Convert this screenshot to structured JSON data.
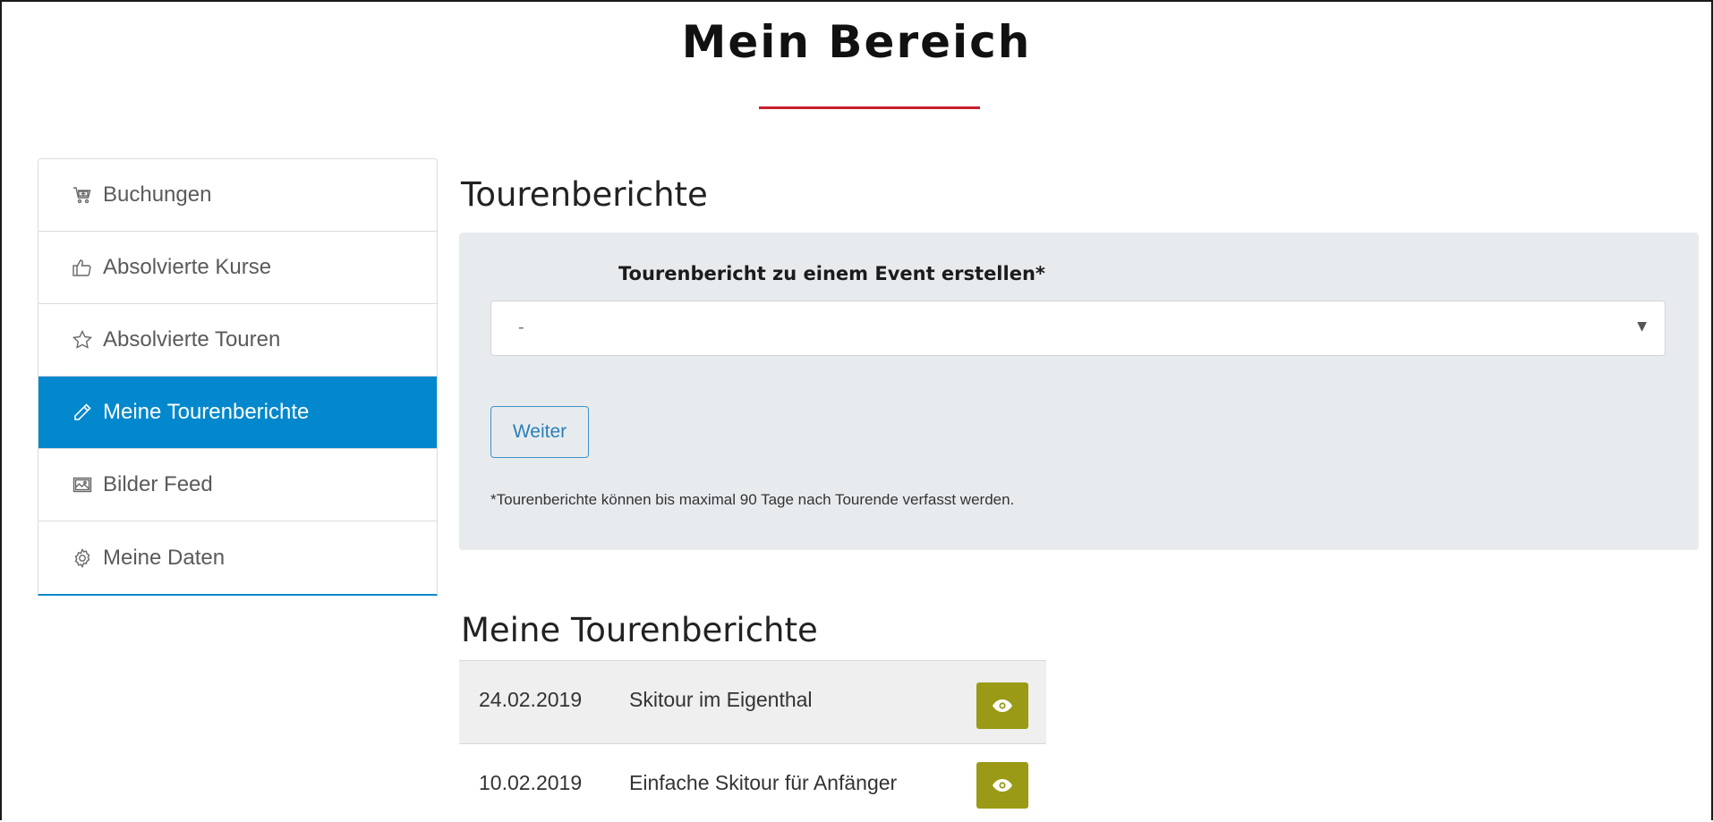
{
  "page": {
    "title": "Mein Bereich"
  },
  "sidebar": {
    "items": [
      {
        "label": "Buchungen",
        "icon": "cart-icon",
        "active": false
      },
      {
        "label": "Absolvierte Kurse",
        "icon": "thumbs-up-icon",
        "active": false
      },
      {
        "label": "Absolvierte Touren",
        "icon": "star-icon",
        "active": false
      },
      {
        "label": "Meine Tourenberichte",
        "icon": "pencil-icon",
        "active": true
      },
      {
        "label": "Bilder Feed",
        "icon": "image-icon",
        "active": false
      },
      {
        "label": "Meine Daten",
        "icon": "gear-icon",
        "active": false
      }
    ],
    "accent_color": "#0488cd"
  },
  "main": {
    "heading": "Tourenberichte",
    "form": {
      "label": "Tourenbericht zu einem Event erstellen*",
      "select_value": "-",
      "select_arrow": "▼",
      "button_label": "Weiter",
      "note": "*Tourenberichte können bis maximal 90 Tage nach Tourende verfasst werden."
    },
    "reports_heading": "Meine Tourenberichte",
    "reports": [
      {
        "date": "24.02.2019",
        "title": "Skitour im Eigenthal",
        "action_icon": "eye-icon"
      },
      {
        "date": "10.02.2019",
        "title": "Einfache Skitour für Anfänger",
        "action_icon": "eye-icon"
      }
    ],
    "view_button_color": "#9a9a17",
    "title_underline_color": "#c8202f"
  }
}
